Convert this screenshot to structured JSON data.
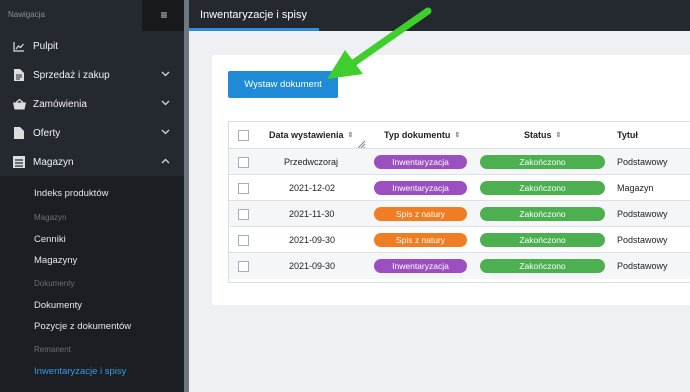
{
  "sidebar": {
    "nav_label": "Nawigacja",
    "menu_icon": "≡",
    "items": [
      {
        "label": "Pulpit",
        "icon": "chart-line-icon",
        "chevron": ""
      },
      {
        "label": "Sprzedaż i zakup",
        "icon": "document-icon",
        "chevron": "⌄"
      },
      {
        "label": "Zamówienia",
        "icon": "basket-icon",
        "chevron": "⌄"
      },
      {
        "label": "Oferty",
        "icon": "file-icon",
        "chevron": "⌄"
      },
      {
        "label": "Magazyn",
        "icon": "warehouse-icon",
        "chevron": "⌃"
      }
    ],
    "submenu": [
      {
        "label": "Indeks produktów",
        "kind": "link"
      },
      {
        "label": "Magazyn",
        "kind": "section"
      },
      {
        "label": "Cenniki",
        "kind": "link"
      },
      {
        "label": "Magazyny",
        "kind": "link"
      },
      {
        "label": "Dokumenty",
        "kind": "section"
      },
      {
        "label": "Dokumenty",
        "kind": "link"
      },
      {
        "label": "Pozycje z dokumentów",
        "kind": "link"
      },
      {
        "label": "Remanent",
        "kind": "section"
      },
      {
        "label": "Inwentaryzacje i spisy",
        "kind": "active"
      }
    ]
  },
  "topbar": {
    "title": "Inwentaryzacje i spisy"
  },
  "main": {
    "issue_button": "Wystaw dokument",
    "columns": [
      "Data wystawienia",
      "Typ dokumentu",
      "Status",
      "Tytuł"
    ],
    "sort_icon": "⇕",
    "rows": [
      {
        "date": "Przedwczoraj",
        "type": "Inwentaryzacja",
        "status": "Zakończono",
        "title": "Podstawowy"
      },
      {
        "date": "2021-12-02",
        "type": "Inwentaryzacja",
        "status": "Zakończono",
        "title": "Magazyn"
      },
      {
        "date": "2021-11-30",
        "type": "Spis z natury",
        "status": "Zakończono",
        "title": "Podstawowy"
      },
      {
        "date": "2021-09-30",
        "type": "Spis z natury",
        "status": "Zakończono",
        "title": "Podstawowy"
      },
      {
        "date": "2021-09-30",
        "type": "Inwentaryzacja",
        "status": "Zakończono",
        "title": "Podstawowy"
      }
    ]
  },
  "colors": {
    "inwentaryzacja": "#9b4fc0",
    "spis": "#f07d22",
    "status": "#4caf50",
    "accent": "#1f8ad6",
    "annotation_arrow": "#3ecf2e"
  }
}
